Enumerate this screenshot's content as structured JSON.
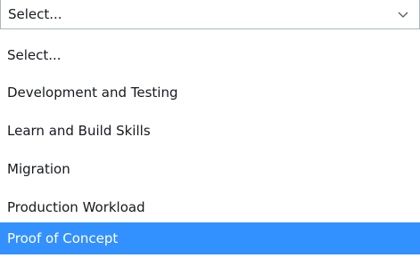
{
  "select": {
    "value": "Select...",
    "icon": "chevron-down-icon"
  },
  "options": [
    {
      "label": "Select..."
    },
    {
      "label": "Development and Testing"
    },
    {
      "label": "Learn and Build Skills"
    },
    {
      "label": "Migration"
    },
    {
      "label": "Production Workload"
    },
    {
      "label": "Proof of Concept"
    }
  ],
  "highlighted_option": "Proof of Concept",
  "colors": {
    "highlight_background": "#3390ff",
    "highlight_text": "#ffffff",
    "text": "#16191f",
    "border": "#aab7b8"
  }
}
